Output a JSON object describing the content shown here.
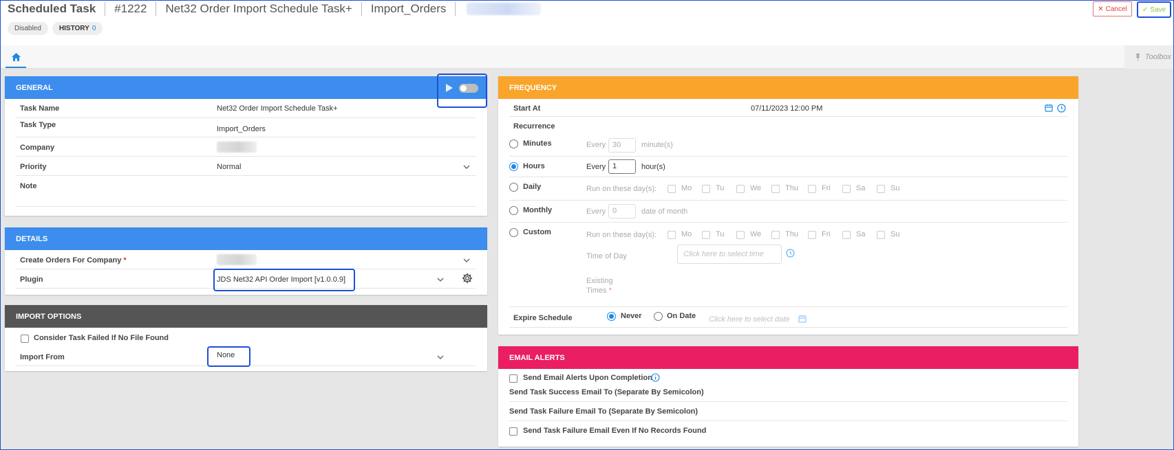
{
  "header": {
    "title": "Scheduled Task",
    "task_id": "#1222",
    "task_name": "Net32 Order Import Schedule Task+",
    "task_type": "Import_Orders",
    "status_badge": "Disabled",
    "history_label": "HISTORY",
    "history_count": "0",
    "cancel_label": "Cancel",
    "save_label": "Save"
  },
  "tabs": {
    "home_icon": "home-icon",
    "toolbox_label": "Toolbox"
  },
  "general": {
    "title": "GENERAL",
    "task_name_label": "Task Name",
    "task_name_value": "Net32 Order Import Schedule Task+",
    "task_type_label": "Task Type",
    "task_type_value": "Import_Orders",
    "company_label": "Company",
    "priority_label": "Priority",
    "priority_value": "Normal",
    "note_label": "Note"
  },
  "details": {
    "title": "DETAILS",
    "create_orders_label": "Create Orders For Company",
    "required_mark": "*",
    "plugin_label": "Plugin",
    "plugin_value": "JDS Net32 API Order Import [v1.0.0.9]"
  },
  "import_options": {
    "title": "IMPORT OPTIONS",
    "consider_failed_label": "Consider Task Failed If No File Found",
    "import_from_label": "Import From",
    "import_from_value": "None"
  },
  "frequency": {
    "title": "FREQUENCY",
    "start_at_label": "Start At",
    "start_at_value": "07/11/2023 12:00 PM",
    "recurrence_label": "Recurrence",
    "minutes_label": "Minutes",
    "minutes_every": "Every",
    "minutes_value": "30",
    "minutes_unit": "minute(s)",
    "hours_label": "Hours",
    "hours_every": "Every",
    "hours_value": "1",
    "hours_unit": "hour(s)",
    "daily_label": "Daily",
    "run_on_days": "Run on these day(s):",
    "days": [
      "Mo",
      "Tu",
      "We",
      "Thu",
      "Fri",
      "Sa",
      "Su"
    ],
    "monthly_label": "Monthly",
    "monthly_every": "Every",
    "monthly_value": "0",
    "monthly_unit": "date of month",
    "custom_label": "Custom",
    "time_of_day_label": "Time of Day",
    "time_placeholder": "Click here to select time",
    "existing_label": "Existing",
    "times_label": "Times",
    "expire_label": "Expire Schedule",
    "never_label": "Never",
    "on_date_label": "On Date",
    "date_placeholder": "Click here to select date"
  },
  "email": {
    "title": "EMAIL ALERTS",
    "send_alerts_label": "Send Email Alerts Upon Completion",
    "success_label": "Send Task Success Email To (Separate By Semicolon)",
    "failure_label": "Send Task Failure Email To (Separate By Semicolon)",
    "failure_even_label": "Send Task Failure Email Even If No Records Found"
  },
  "colors": {
    "blue_header": "#3c8ded",
    "dark_header": "#555555",
    "orange_header": "#f9a52b",
    "pink_header": "#e91e63",
    "highlight": "#1d4fd8"
  }
}
